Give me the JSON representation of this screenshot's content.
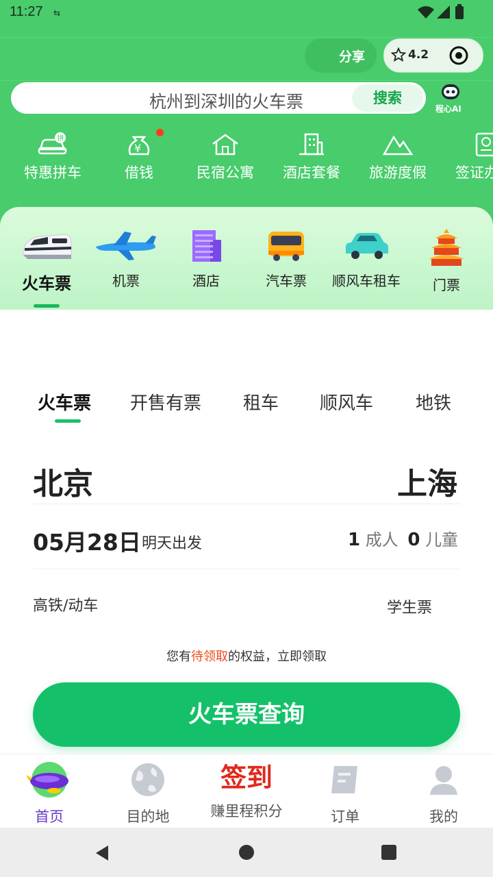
{
  "status_bar": {
    "time": "11:27"
  },
  "header": {
    "share_label": "分享",
    "rating": "4.2",
    "search_placeholder": "杭州到深圳的火车票",
    "search_button": "搜索",
    "ai_label": "程心AI"
  },
  "services": [
    {
      "label": "特惠拼车",
      "icon": "carpool-car-icon"
    },
    {
      "label": "借钱",
      "icon": "money-bag-icon"
    },
    {
      "label": "民宿公寓",
      "icon": "house-icon"
    },
    {
      "label": "酒店套餐",
      "icon": "hotel-building-icon"
    },
    {
      "label": "旅游度假",
      "icon": "mountain-icon"
    },
    {
      "label": "签证办",
      "icon": "passport-icon"
    }
  ],
  "categories": [
    {
      "label": "火车票",
      "icon": "train-icon"
    },
    {
      "label": "机票",
      "icon": "airplane-icon"
    },
    {
      "label": "酒店",
      "icon": "hotel-icon"
    },
    {
      "label": "汽车票",
      "icon": "bus-icon"
    },
    {
      "label": "顺风车租车",
      "icon": "car-icon"
    },
    {
      "label": "门票",
      "icon": "pagoda-icon"
    }
  ],
  "tabs": [
    "火车票",
    "开售有票",
    "租车",
    "顺风车",
    "地铁"
  ],
  "booking": {
    "from_city": "北京",
    "to_city": "上海",
    "date": "05月28日",
    "date_note": "明天出发",
    "adults_count": "1",
    "adults_label": "成人",
    "children_count": "0",
    "children_label": "儿童",
    "train_type": "高铁/动车",
    "student_ticket": "学生票",
    "benefit_prefix": "您有",
    "benefit_highlight": "待领取",
    "benefit_suffix": "的权益，立即领取",
    "query_button": "火车票查询"
  },
  "bottom_nav": [
    {
      "label": "首页",
      "icon": "home-blimp-icon"
    },
    {
      "label": "目的地",
      "icon": "globe-icon"
    },
    {
      "label": "赚里程积分",
      "badge_text": "签到",
      "icon": "checkin-icon"
    },
    {
      "label": "订单",
      "icon": "order-icon"
    },
    {
      "label": "我的",
      "icon": "profile-icon"
    }
  ],
  "colors": {
    "brand_green": "#48cc6c",
    "button_green": "#14c16a",
    "active_purple": "#6a38c8",
    "highlight": "#ef4a1c"
  }
}
